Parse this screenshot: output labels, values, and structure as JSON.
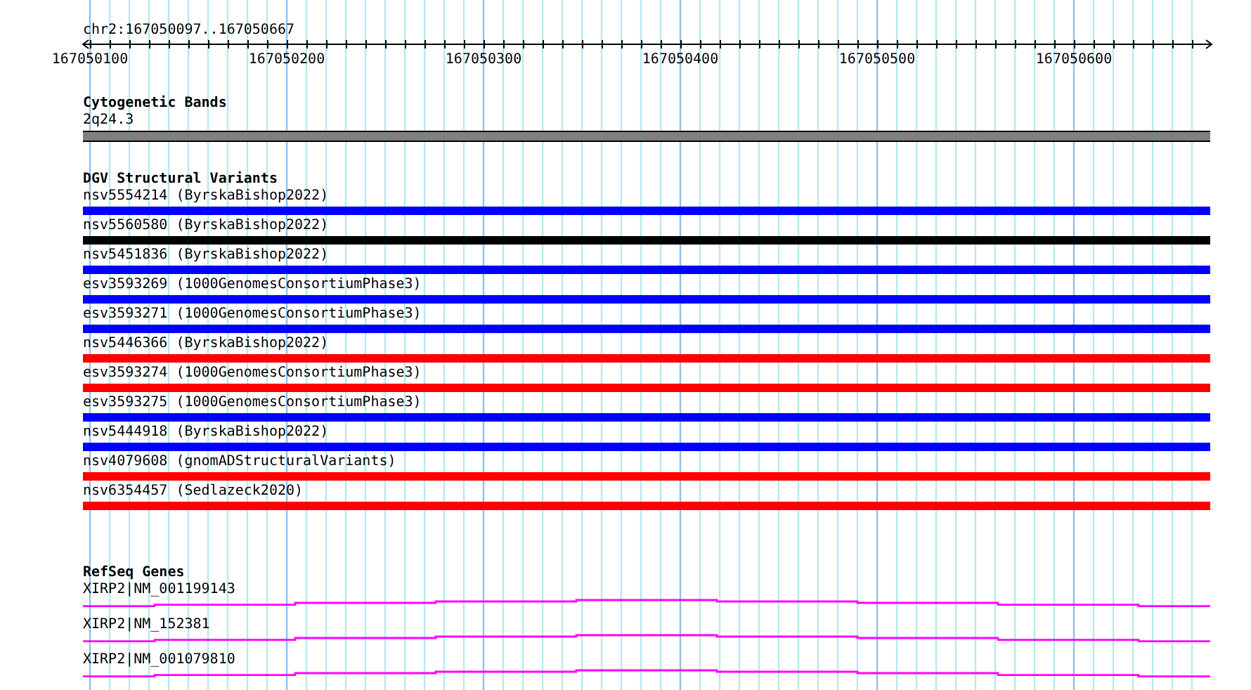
{
  "ruler": {
    "location": "chr2:167050097..167050667",
    "ticks": [
      "167050100",
      "167050200",
      "167050300",
      "167050400",
      "167050500",
      "167050600"
    ]
  },
  "cytogenetic_bands": {
    "title": "Cytogenetic Bands",
    "band": "2q24.3"
  },
  "dgv_structural_variants": {
    "title": "DGV Structural Variants",
    "variants": [
      {
        "label": "nsv5554214 (ByrskaBishop2022)",
        "color": "#0000ff"
      },
      {
        "label": "nsv5560580 (ByrskaBishop2022)",
        "color": "#000000"
      },
      {
        "label": "nsv5451836 (ByrskaBishop2022)",
        "color": "#0000ff"
      },
      {
        "label": "esv3593269 (1000GenomesConsortiumPhase3)",
        "color": "#0000ff"
      },
      {
        "label": "esv3593271 (1000GenomesConsortiumPhase3)",
        "color": "#0000ff"
      },
      {
        "label": "nsv5446366 (ByrskaBishop2022)",
        "color": "#ff0000"
      },
      {
        "label": "esv3593274 (1000GenomesConsortiumPhase3)",
        "color": "#ff0000"
      },
      {
        "label": "esv3593275 (1000GenomesConsortiumPhase3)",
        "color": "#0000ff"
      },
      {
        "label": "nsv5444918 (ByrskaBishop2022)",
        "color": "#0000ff"
      },
      {
        "label": "nsv4079608 (gnomADStructuralVariants)",
        "color": "#ff0000"
      },
      {
        "label": "nsv6354457 (Sedlazeck2020)",
        "color": "#ff0000"
      }
    ]
  },
  "refseq_genes": {
    "title": "RefSeq Genes",
    "genes": [
      {
        "label": "XIRP2|NM_001199143"
      },
      {
        "label": "XIRP2|NM_152381"
      },
      {
        "label": "XIRP2|NM_001079810"
      }
    ]
  }
}
